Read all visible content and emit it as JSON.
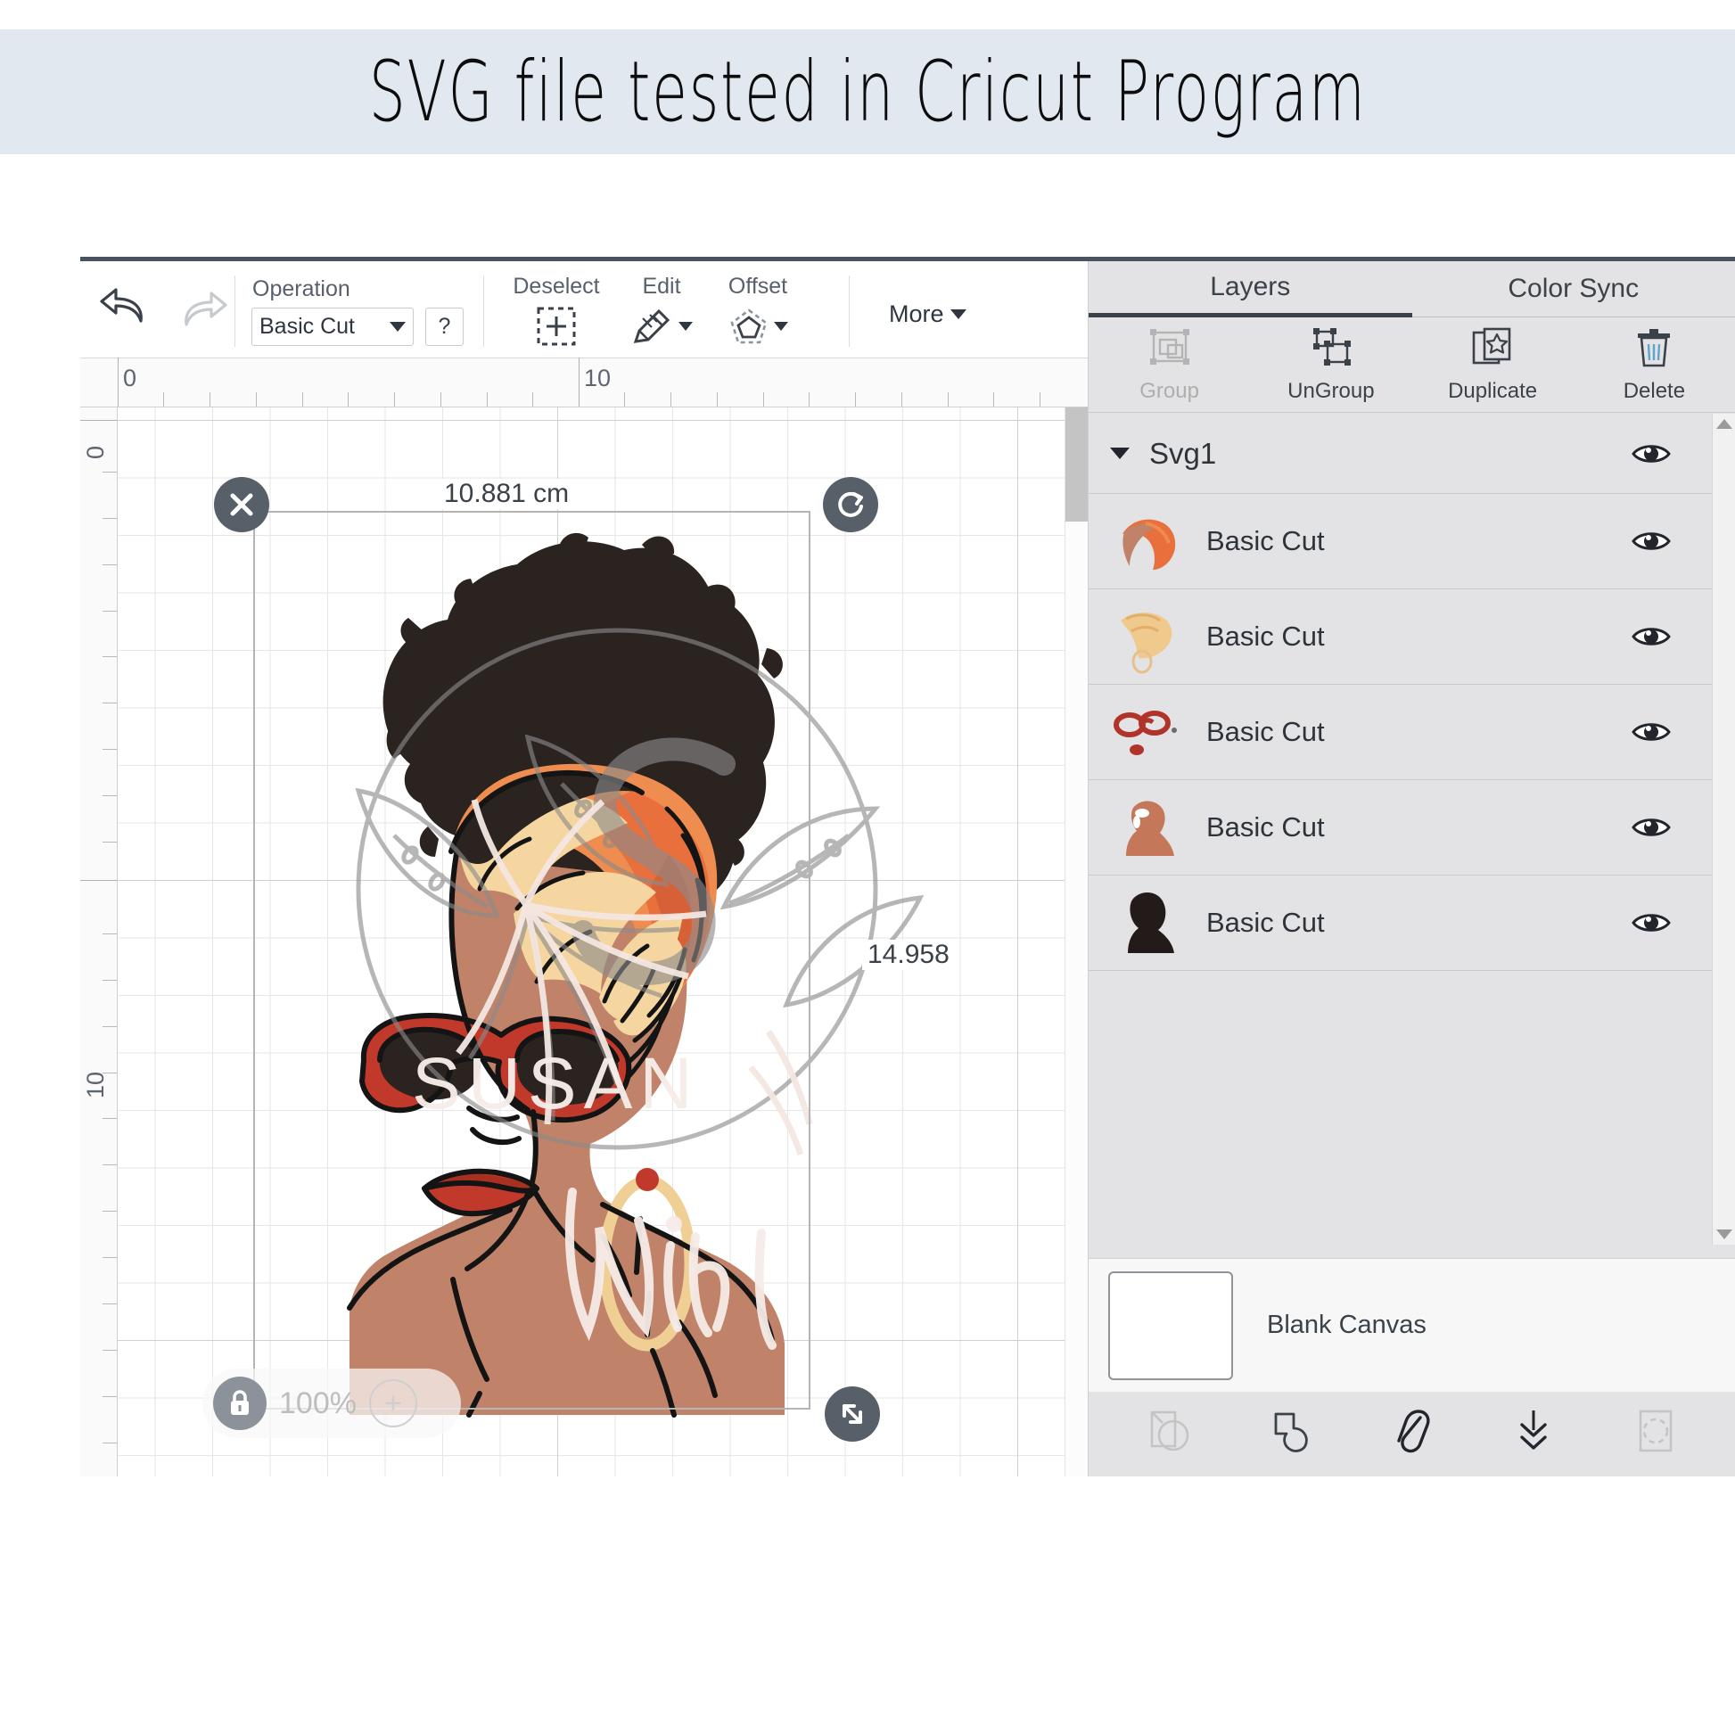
{
  "banner": {
    "text": "SVG file tested in Cricut Program",
    "background": "#e2e8f0"
  },
  "toolbar": {
    "undo_icon": "undo-arrow-icon",
    "redo_icon": "redo-arrow-icon",
    "operation_label": "Operation",
    "operation_value": "Basic Cut",
    "operation_help": "?",
    "deselect_label": "Deselect",
    "edit_label": "Edit",
    "offset_label": "Offset",
    "more_label": "More"
  },
  "canvas": {
    "ruler_h_numbers": [
      "0",
      "10"
    ],
    "ruler_v_numbers": [
      "0",
      "10"
    ],
    "width_value": "10.881 cm",
    "height_value": "14.958",
    "zoom_value": "100%",
    "zoom_in_label": "+",
    "delete_icon": "close-x-icon",
    "rotate_icon": "rotate-icon",
    "resize_icon": "resize-diagonal-icon",
    "lock_icon": "lock-icon",
    "artwork_colors": {
      "hair": "#2b2320",
      "skin": "#c08268",
      "wrap_orange": "#ef8c4f",
      "wrap_orange_dark": "#e9703c",
      "wrap_cream": "#f6d6a0",
      "glasses_red": "#c0392b",
      "lips_red": "#c0392b",
      "earring_gold": "#efcf94",
      "outline": "#141414"
    },
    "watermark_text_1": "SUSAN",
    "watermark_text_2": "With"
  },
  "panel": {
    "tabs": [
      {
        "label": "Layers",
        "active": true
      },
      {
        "label": "Color Sync",
        "active": false
      }
    ],
    "actions": [
      {
        "label": "Group",
        "icon": "group-icon",
        "disabled": true
      },
      {
        "label": "UnGroup",
        "icon": "ungroup-icon",
        "disabled": false
      },
      {
        "label": "Duplicate",
        "icon": "duplicate-icon",
        "disabled": false
      },
      {
        "label": "Delete",
        "icon": "trash-icon",
        "disabled": false
      }
    ],
    "group_name": "Svg1",
    "layers": [
      {
        "label": "Basic Cut",
        "thumb": "orange-wrap-thumb",
        "visible": true
      },
      {
        "label": "Basic Cut",
        "thumb": "cream-wrap-thumb",
        "visible": true
      },
      {
        "label": "Basic Cut",
        "thumb": "glasses-lips-thumb",
        "visible": true
      },
      {
        "label": "Basic Cut",
        "thumb": "skin-silhouette-thumb",
        "visible": true
      },
      {
        "label": "Basic Cut",
        "thumb": "dark-silhouette-thumb",
        "visible": true
      }
    ],
    "canvas_info_label": "Blank Canvas",
    "bottom_icons": [
      {
        "icon": "slice-icon",
        "disabled": true
      },
      {
        "icon": "weld-icon",
        "disabled": false
      },
      {
        "icon": "attach-paperclip-icon",
        "disabled": false
      },
      {
        "icon": "flatten-icon",
        "disabled": false
      },
      {
        "icon": "contour-icon",
        "disabled": true
      }
    ]
  }
}
